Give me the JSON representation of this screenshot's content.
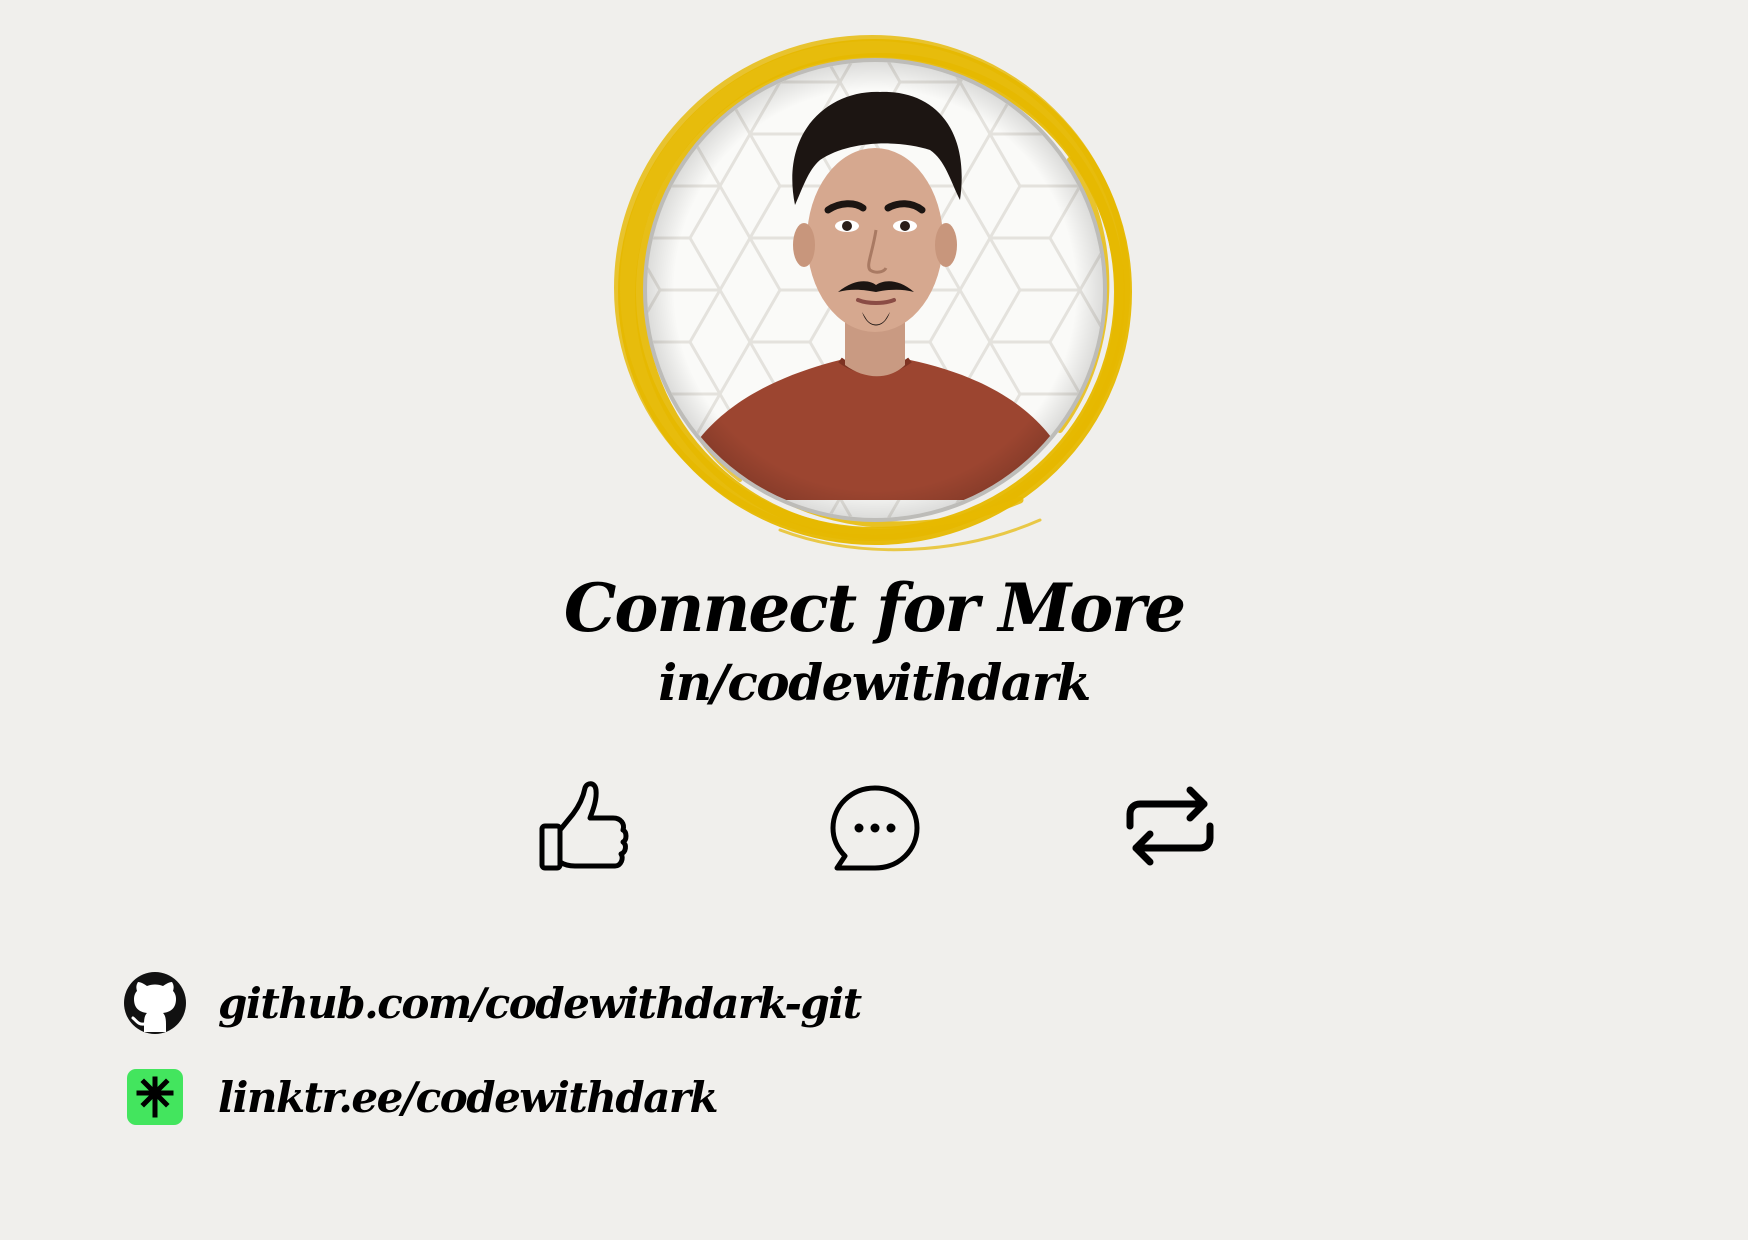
{
  "profile": {
    "photo_alt": "",
    "ring_color": "#e6b800"
  },
  "title": "Connect for More",
  "handle": "in/codewithdark",
  "actions": [
    {
      "icon": "thumbs-up-icon"
    },
    {
      "icon": "chat-bubble-icon"
    },
    {
      "icon": "repost-icon"
    }
  ],
  "links": [
    {
      "icon": "github-icon",
      "label": "github.com/codewithdark-git"
    },
    {
      "icon": "linktree-icon",
      "label": "linktr.ee/codewithdark",
      "icon_color": "#43e55e"
    }
  ]
}
